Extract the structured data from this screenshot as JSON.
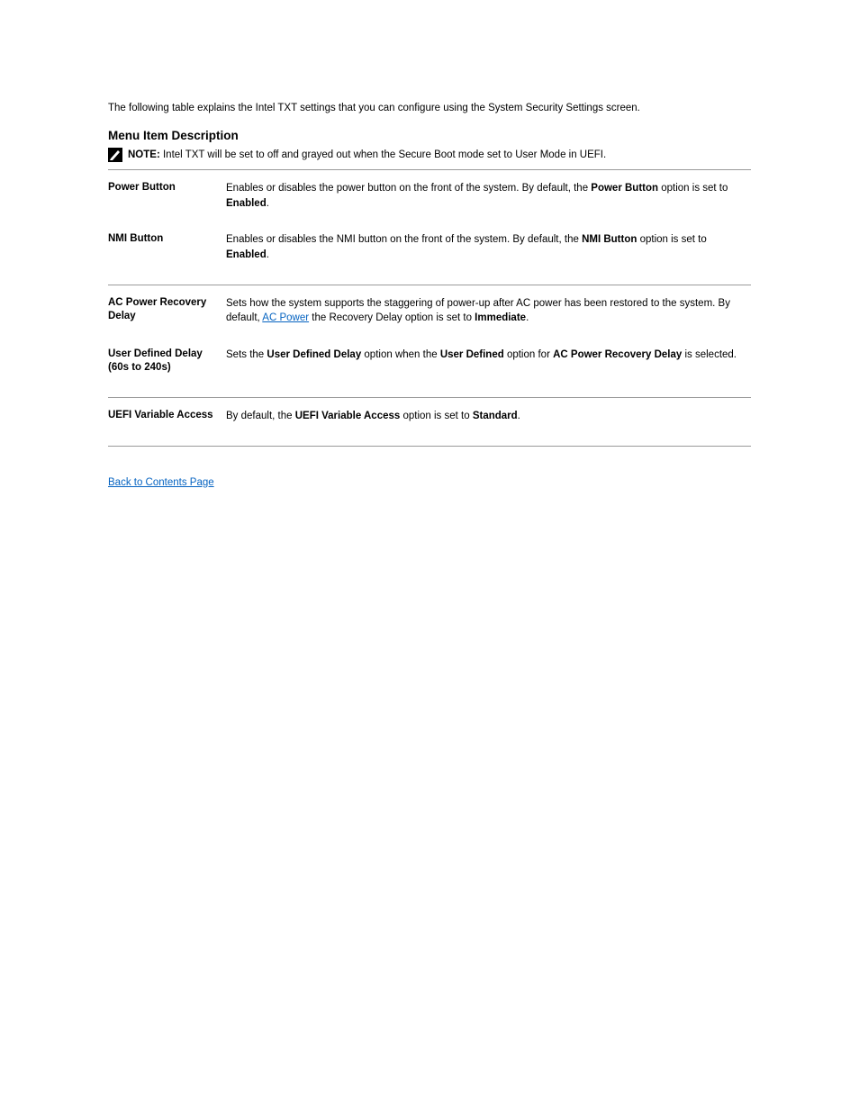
{
  "intro": "The following table explains the Intel TXT settings that you can configure using the System Security Settings screen.",
  "heading": "Menu Item Description",
  "note": {
    "label": "NOTE: ",
    "text": "Intel TXT will be set to off and grayed out when the Secure Boot mode set to User Mode in UEFI."
  },
  "rows": [
    {
      "left": "Power Button",
      "right_parts": [
        {
          "t": "text",
          "v": "Enables or disables the power button on the front of the system. By default, the "
        },
        {
          "t": "bold",
          "v": "Power Button"
        },
        {
          "t": "text",
          "v": " option is set to "
        },
        {
          "t": "bold",
          "v": "Enabled"
        },
        {
          "t": "text",
          "v": "."
        }
      ]
    },
    {
      "left": "NMI Button",
      "right_parts": [
        {
          "t": "text",
          "v": "Enables or disables the NMI button on the front of the system. By default, the "
        },
        {
          "t": "bold",
          "v": "NMI Button"
        },
        {
          "t": "text",
          "v": " option is set to "
        },
        {
          "t": "bold",
          "v": "Enabled"
        },
        {
          "t": "text",
          "v": "."
        }
      ]
    },
    {
      "left": "AC Power Recovery Delay",
      "right_parts": [
        {
          "t": "text",
          "v": "Sets how the system supports the staggering of power-up after AC power has been restored to the system. By default, "
        },
        {
          "t": "link",
          "v": "AC Power"
        },
        {
          "t": "text",
          "v": " the Recovery Delay option is set to "
        },
        {
          "t": "bold",
          "v": "Immediate"
        },
        {
          "t": "text",
          "v": "."
        }
      ]
    },
    {
      "left": "User Defined Delay (60s to 240s)",
      "right_parts": [
        {
          "t": "text",
          "v": "Sets the "
        },
        {
          "t": "bold",
          "v": "User Defined Delay"
        },
        {
          "t": "text",
          "v": " option when the "
        },
        {
          "t": "bold",
          "v": "User Defined"
        },
        {
          "t": "text",
          "v": " option for "
        },
        {
          "t": "bold",
          "v": "AC Power Recovery Delay"
        },
        {
          "t": "text",
          "v": " is selected."
        }
      ]
    },
    {
      "left": "UEFI Variable Access",
      "right_parts": [
        {
          "t": "text",
          "v": "By default, the "
        },
        {
          "t": "bold",
          "v": "UEFI Variable Access"
        },
        {
          "t": "text",
          "v": " option is set to "
        },
        {
          "t": "bold",
          "v": "Standard"
        },
        {
          "t": "text",
          "v": "."
        }
      ]
    }
  ],
  "back": "Back to Contents Page"
}
